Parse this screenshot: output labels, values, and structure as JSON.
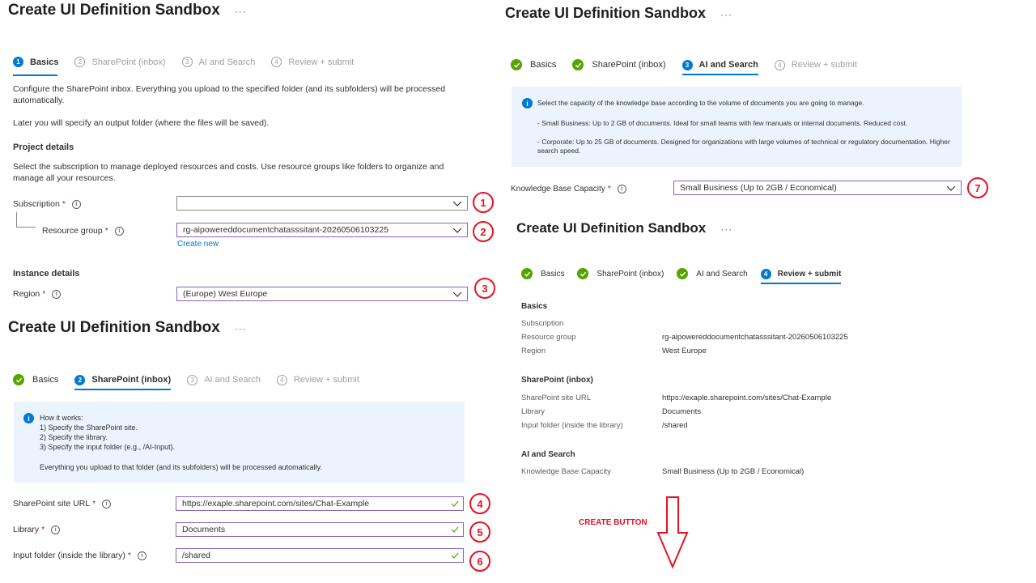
{
  "colors": {
    "accent": "#0078d4",
    "success": "#57a300",
    "annotation": "#e81123",
    "required": "#a4262c"
  },
  "icons": [
    "check-circle-icon",
    "info-icon",
    "chevron-down-icon",
    "checkmark-icon",
    "down-arrow-icon"
  ],
  "panel1": {
    "title": "Create UI Definition Sandbox",
    "more": "···",
    "tabs": [
      {
        "num": "1",
        "label": "Basics",
        "state": "active"
      },
      {
        "num": "2",
        "label": "SharePoint (inbox)",
        "state": "inactive"
      },
      {
        "num": "3",
        "label": "AI and Search",
        "state": "inactive"
      },
      {
        "num": "4",
        "label": "Review + submit",
        "state": "inactive"
      }
    ],
    "intro1": "Configure the SharePoint inbox. Everything you upload to the specified folder (and its subfolders) will be processed automatically.",
    "intro2": "Later you will specify an output folder (where the files will be saved).",
    "project_heading": "Project details",
    "project_desc": "Select the subscription to manage deployed resources and costs. Use resource groups like folders to organize and manage all your resources.",
    "subscription_label": "Subscription",
    "subscription_value": "",
    "resource_group_label": "Resource group",
    "resource_group_value": "rg-aipowereddocumentchatasssitant-20260506103225",
    "create_new": "Create new",
    "instance_heading": "Instance details",
    "region_label": "Region",
    "region_value": "(Europe) West Europe",
    "markers": [
      "1",
      "2",
      "3"
    ]
  },
  "panel2": {
    "title": "Create UI Definition Sandbox",
    "more": "···",
    "tabs": [
      {
        "num": "",
        "label": "Basics",
        "state": "done"
      },
      {
        "num": "2",
        "label": "SharePoint (inbox)",
        "state": "active"
      },
      {
        "num": "3",
        "label": "AI and Search",
        "state": "inactive"
      },
      {
        "num": "4",
        "label": "Review + submit",
        "state": "inactive"
      }
    ],
    "info_lines": [
      "How it works:",
      "1) Specify the SharePoint site.",
      "2) Specify the library.",
      "3) Specify the input folder (e.g., /AI-Input)."
    ],
    "info_footer": "Everything you upload to that folder (and its subfolders) will be processed automatically.",
    "site_label": "SharePoint site URL",
    "site_value": "https://exaple.sharepoint.com/sites/Chat-Example",
    "library_label": "Library",
    "library_value": "Documents",
    "folder_label": "Input folder (inside the library)",
    "folder_value": "/shared",
    "markers": [
      "4",
      "5",
      "6"
    ]
  },
  "panel3": {
    "title": "Create UI Definition Sandbox",
    "more": "···",
    "tabs": [
      {
        "num": "",
        "label": "Basics",
        "state": "done"
      },
      {
        "num": "",
        "label": "SharePoint (inbox)",
        "state": "done"
      },
      {
        "num": "3",
        "label": "AI and Search",
        "state": "active"
      },
      {
        "num": "4",
        "label": "Review + submit",
        "state": "inactive"
      }
    ],
    "info_main": "Select the capacity of the knowledge base according to the volume of documents you are going to manage.",
    "info_small": "- Small Business: Up to 2 GB of documents. Ideal for small teams with few manuals or internal documents. Reduced cost.",
    "info_corp": "- Corporate: Up to 25 GB of documents. Designed for organizations with large volumes of technical or regulatory documentation. Higher search speed.",
    "capacity_label": "Knowledge Base Capacity",
    "capacity_value": "Small Business (Up to 2GB / Economical)",
    "marker": "7"
  },
  "panel4": {
    "title": "Create UI Definition Sandbox",
    "more": "···",
    "tabs": [
      {
        "num": "",
        "label": "Basics",
        "state": "done"
      },
      {
        "num": "",
        "label": "SharePoint (inbox)",
        "state": "done"
      },
      {
        "num": "",
        "label": "AI and Search",
        "state": "done"
      },
      {
        "num": "4",
        "label": "Review + submit",
        "state": "active"
      }
    ],
    "basics_heading": "Basics",
    "basics_rows": [
      {
        "label": "Subscription",
        "value": ""
      },
      {
        "label": "Resource group",
        "value": "rg-aipowereddocumentchatasssitant-20260506103225"
      },
      {
        "label": "Region",
        "value": "West Europe"
      }
    ],
    "sp_heading": "SharePoint (inbox)",
    "sp_rows": [
      {
        "label": "SharePoint site URL",
        "value": "https://exaple.sharepoint.com/sites/Chat-Example"
      },
      {
        "label": "Library",
        "value": "Documents"
      },
      {
        "label": "Input folder (inside the library)",
        "value": "/shared"
      }
    ],
    "ai_heading": "AI and Search",
    "ai_rows": [
      {
        "label": "Knowledge Base Capacity",
        "value": "Small Business (Up to 2GB / Economical)"
      }
    ],
    "create_annotation": "CREATE BUTTON"
  }
}
